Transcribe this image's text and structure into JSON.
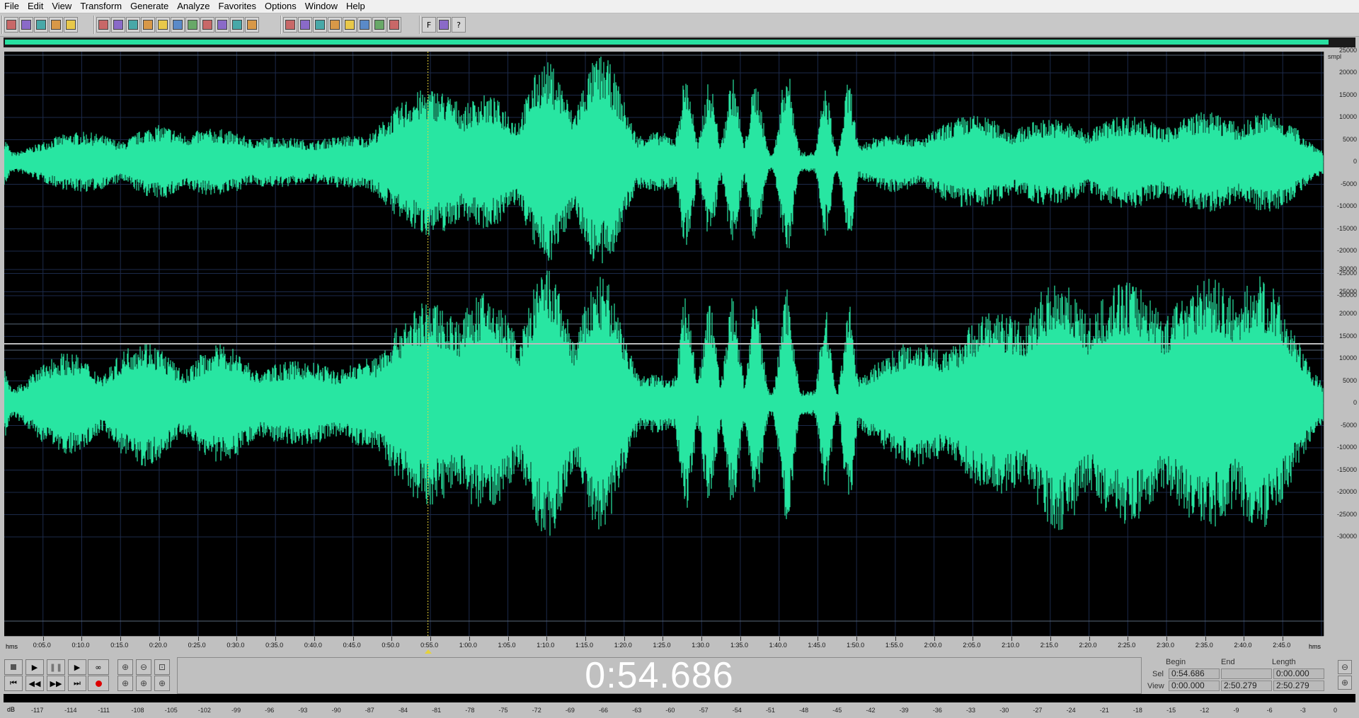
{
  "menu": [
    "File",
    "Edit",
    "View",
    "Transform",
    "Generate",
    "Analyze",
    "Favorites",
    "Options",
    "Window",
    "Help"
  ],
  "toolbar": {
    "group1": [
      "new-file-icon",
      "open-file-icon",
      "save-icon",
      "save-as-icon",
      "close-file-icon"
    ],
    "group2": [
      "undo-icon",
      "redo-icon",
      "repeat-icon",
      "copy-icon",
      "copy-to-new-icon",
      "cut-icon",
      "paste-icon",
      "paste-new-icon",
      "mix-paste-icon",
      "trim-icon",
      "zoom-fit-icon"
    ],
    "group3": [
      "spectral-view-icon",
      "waveform-view-icon",
      "envelope-icon",
      "dual-channel-icon",
      "mono-channel-icon",
      "cd-icon",
      "cue-icon",
      "disk-icon"
    ],
    "group4": [
      "favorites-icon",
      "script-icon",
      "help-icon"
    ],
    "help_glyph": "?",
    "fx_glyph": "F"
  },
  "ruler": {
    "unit": "smpl",
    "top_channel_labels": [
      "25000",
      "20000",
      "15000",
      "10000",
      "5000",
      "0",
      "-5000",
      "-10000",
      "-15000",
      "-20000",
      "-25000",
      "-30000"
    ],
    "bottom_channel_labels": [
      "30000",
      "25000",
      "20000",
      "15000",
      "10000",
      "5000",
      "0",
      "-5000",
      "-10000",
      "-15000",
      "-20000",
      "-25000",
      "-30000"
    ]
  },
  "timeline": {
    "start_label": "hms",
    "end_label": "hms",
    "ticks": [
      "0:05.0",
      "0:10.0",
      "0:15.0",
      "0:20.0",
      "0:25.0",
      "0:30.0",
      "0:35.0",
      "0:40.0",
      "0:45.0",
      "0:50.0",
      "0:55.0",
      "1:00.0",
      "1:05.0",
      "1:10.0",
      "1:15.0",
      "1:20.0",
      "1:25.0",
      "1:30.0",
      "1:35.0",
      "1:40.0",
      "1:45.0",
      "1:50.0",
      "1:55.0",
      "2:00.0",
      "2:05.0",
      "2:10.0",
      "2:15.0",
      "2:20.0",
      "2:25.0",
      "2:30.0",
      "2:35.0",
      "2:40.0",
      "2:45.0"
    ]
  },
  "playhead_seconds": 54.686,
  "duration_seconds": 170.279,
  "waveform_color": "#28e6a2",
  "time_display": "0:54.686",
  "selection": {
    "headers": {
      "begin": "Begin",
      "end": "End",
      "length": "Length"
    },
    "sel_label": "Sel",
    "view_label": "View",
    "sel": {
      "begin": "0:54.686",
      "end": "",
      "length": "0:00.000"
    },
    "view": {
      "begin": "0:00.000",
      "end": "2:50.279",
      "length": "2:50.279"
    }
  },
  "meter_scale": {
    "unit": "dB",
    "ticks": [
      "-117",
      "-114",
      "-111",
      "-108",
      "-105",
      "-102",
      "-99",
      "-96",
      "-93",
      "-90",
      "-87",
      "-84",
      "-81",
      "-78",
      "-75",
      "-72",
      "-69",
      "-66",
      "-63",
      "-60",
      "-57",
      "-54",
      "-51",
      "-48",
      "-45",
      "-42",
      "-39",
      "-36",
      "-33",
      "-30",
      "-27",
      "-24",
      "-21",
      "-18",
      "-15",
      "-12",
      "-9",
      "-6",
      "-3",
      "0"
    ]
  }
}
